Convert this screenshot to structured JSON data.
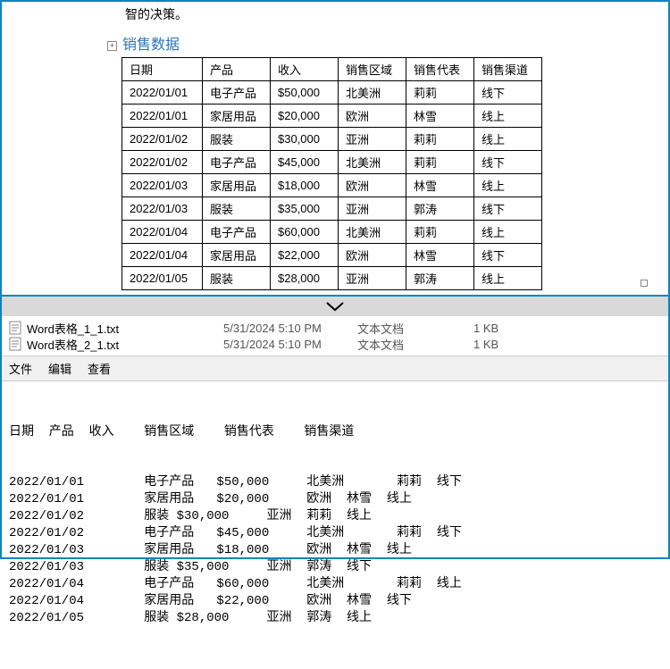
{
  "intro_text": "智的决策。",
  "section_title": "销售数据",
  "chart_data": {
    "type": "table",
    "columns": [
      "日期",
      "产品",
      "收入",
      "销售区域",
      "销售代表",
      "销售渠道"
    ],
    "rows": [
      [
        "2022/01/01",
        "电子产品",
        "$50,000",
        "北美洲",
        "莉莉",
        "线下"
      ],
      [
        "2022/01/01",
        "家居用品",
        "$20,000",
        "欧洲",
        "林雪",
        "线上"
      ],
      [
        "2022/01/02",
        "服装",
        "$30,000",
        "亚洲",
        "莉莉",
        "线上"
      ],
      [
        "2022/01/02",
        "电子产品",
        "$45,000",
        "北美洲",
        "莉莉",
        "线下"
      ],
      [
        "2022/01/03",
        "家居用品",
        "$18,000",
        "欧洲",
        "林雪",
        "线上"
      ],
      [
        "2022/01/03",
        "服装",
        "$35,000",
        "亚洲",
        "郭涛",
        "线下"
      ],
      [
        "2022/01/04",
        "电子产品",
        "$60,000",
        "北美洲",
        "莉莉",
        "线上"
      ],
      [
        "2022/01/04",
        "家居用品",
        "$22,000",
        "欧洲",
        "林雪",
        "线下"
      ],
      [
        "2022/01/05",
        "服装",
        "$28,000",
        "亚洲",
        "郭涛",
        "线上"
      ]
    ]
  },
  "files": [
    {
      "name": "Word表格_1_1.txt",
      "date": "5/31/2024 5:10 PM",
      "type": "文本文档",
      "size": "1 KB"
    },
    {
      "name": "Word表格_2_1.txt",
      "date": "5/31/2024 5:10 PM",
      "type": "文本文档",
      "size": "1 KB"
    }
  ],
  "menu": {
    "file": "文件",
    "edit": "编辑",
    "view": "查看"
  },
  "textview": {
    "header": "日期  产品  收入    销售区域    销售代表    销售渠道",
    "lines": [
      "2022/01/01        电子产品   $50,000     北美洲       莉莉  线下",
      "2022/01/01        家居用品   $20,000     欧洲  林雪  线上",
      "2022/01/02        服装 $30,000     亚洲  莉莉  线上",
      "2022/01/02        电子产品   $45,000     北美洲       莉莉  线下",
      "2022/01/03        家居用品   $18,000     欧洲  林雪  线上",
      "2022/01/03        服装 $35,000     亚洲  郭涛  线下",
      "2022/01/04        电子产品   $60,000     北美洲       莉莉  线上",
      "2022/01/04        家居用品   $22,000     欧洲  林雪  线下",
      "2022/01/05        服装 $28,000     亚洲  郭涛  线上"
    ]
  }
}
